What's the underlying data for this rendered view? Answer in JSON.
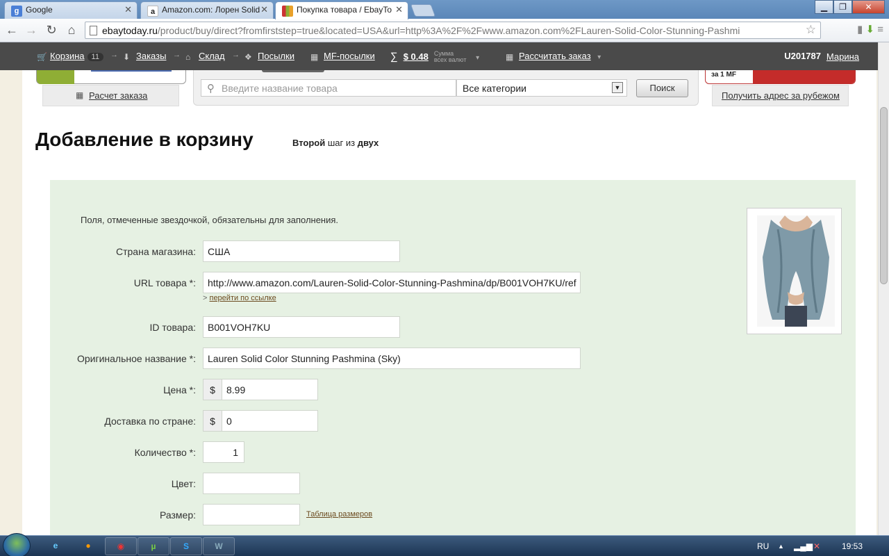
{
  "browser": {
    "tabs": [
      {
        "title": "Google",
        "icon": "google-favicon"
      },
      {
        "title": "Amazon.com: Лорен Solid",
        "icon": "amazon-favicon"
      },
      {
        "title": "Покупка товара / EbayTo",
        "icon": "ebaytoday-favicon"
      }
    ],
    "url_host": "ebaytoday.ru",
    "url_rest": "/product/buy/direct?fromfirststep=true&located=USA&url=http%3A%2F%2Fwww.amazon.com%2FLauren-Solid-Color-Stunning-Pashmi"
  },
  "sitenav": {
    "cart_label": "Корзина",
    "cart_count": "11",
    "orders_label": "Заказы",
    "warehouse_label": "Склад",
    "parcels_label": "Посылки",
    "mf_parcels_label": "MF-посылки",
    "sum_symbol": "∑",
    "sum_value": "$ 0.48",
    "sum_note_line1": "Сумма",
    "sum_note_line2": "всех валют",
    "calc_order_label": "Рассчитать заказ",
    "user_id": "U201787",
    "user_name": "Марина"
  },
  "header": {
    "calc_link": "Расчет заказа",
    "search_placeholder": "Введите название товара",
    "category_value": "Все категории",
    "search_button": "Поиск",
    "promo_text": "за 1 MF",
    "address_link": "Получить адрес за рубежом"
  },
  "page": {
    "title": "Добавление в корзину",
    "step_a": "Второй",
    "step_b": " шаг из ",
    "step_c": "двух"
  },
  "form": {
    "note": "Поля, отмеченные звездочкой, обязательны для заполнения.",
    "country_label": "Страна магазина:",
    "country_value": "США",
    "url_label": "URL товара *:",
    "url_value": "http://www.amazon.com/Lauren-Solid-Color-Stunning-Pashmina/dp/B001VOH7KU/ref",
    "url_link_prefix": "> ",
    "url_link": "перейти по ссылке",
    "id_label": "ID товара:",
    "id_value": "B001VOH7KU",
    "name_label": "Оригинальное название *:",
    "name_value": "Lauren Solid Color Stunning Pashmina (Sky)",
    "price_label": "Цена *:",
    "currency": "$",
    "price_value": "8.99",
    "shipping_label": "Доставка по стране:",
    "shipping_value": "0",
    "qty_label": "Количество *:",
    "qty_value": "1",
    "color_label": "Цвет:",
    "color_value": "",
    "size_label": "Размер:",
    "size_value": "",
    "size_table_link": "Таблица размеров"
  },
  "taskbar": {
    "lang": "RU",
    "clock": "19:53",
    "apps": [
      "ie-icon",
      "firefox-icon",
      "chrome-icon",
      "utorrent-icon",
      "skype-icon",
      "word-icon"
    ]
  },
  "colors": {
    "site_nav_bg": "#4a4a4a",
    "form_bg": "#e6f1e3",
    "promo_green": "#8fae35",
    "promo_red": "#c42c2a"
  }
}
